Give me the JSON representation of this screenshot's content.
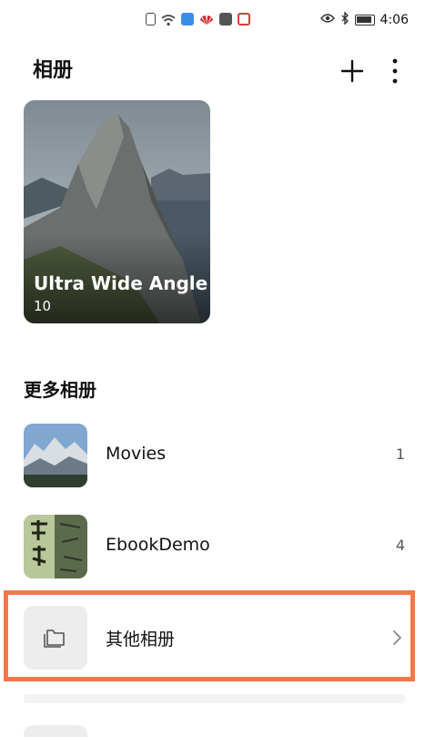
{
  "status_bar": {
    "time": "4:06"
  },
  "header": {
    "title": "相册"
  },
  "featured_album": {
    "title": "Ultra Wide Angle",
    "count": "10"
  },
  "section": {
    "title": "更多相册"
  },
  "albums": [
    {
      "label": "Movies",
      "count": "1"
    },
    {
      "label": "EbookDemo",
      "count": "4"
    },
    {
      "label": "其他相册",
      "count": ""
    }
  ],
  "colors": {
    "highlight": "#f2784b"
  }
}
